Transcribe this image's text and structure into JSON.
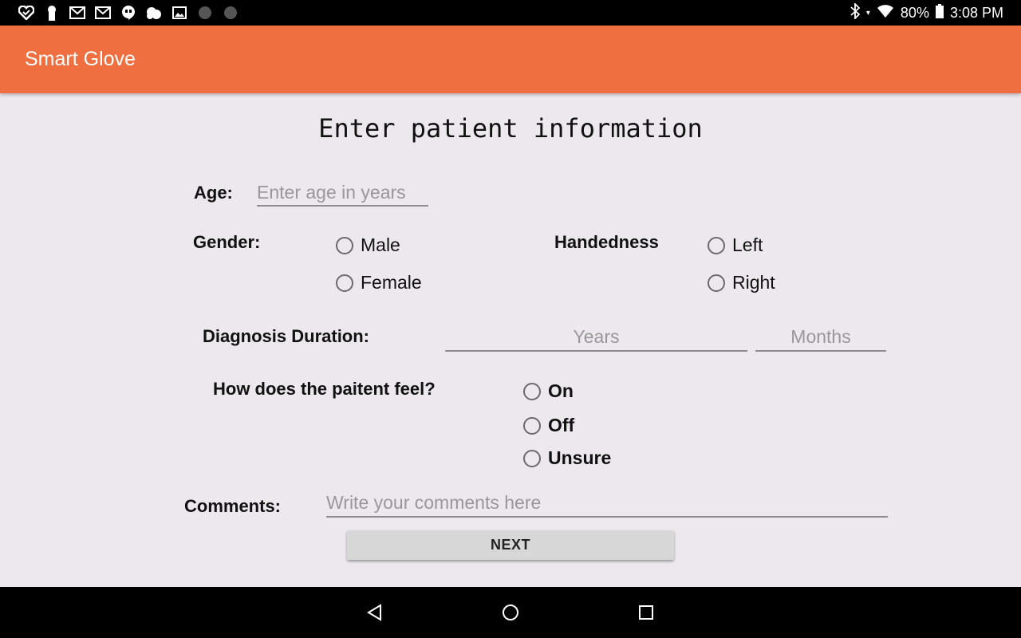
{
  "status_bar": {
    "notification_icons": [
      "heart-icon",
      "keyhole-icon",
      "mail-icon",
      "mail-icon",
      "hangouts-icon",
      "weather-icon",
      "image-icon",
      "circle-icon",
      "circle-icon"
    ],
    "battery": "80%",
    "time": "3:08 PM"
  },
  "app_bar": {
    "title": "Smart Glove",
    "color": "#ef6f40"
  },
  "form": {
    "title": "Enter patient information",
    "age": {
      "label": "Age:",
      "placeholder": "Enter age in years"
    },
    "gender": {
      "label": "Gender:",
      "options": [
        "Male",
        "Female"
      ]
    },
    "handedness": {
      "label": "Handedness",
      "options": [
        "Left",
        "Right"
      ]
    },
    "diagnosis": {
      "label": "Diagnosis Duration:",
      "years_placeholder": "Years",
      "months_placeholder": "Months"
    },
    "feel": {
      "label": "How does the paitent feel?",
      "options": [
        "On",
        "Off",
        "Unsure"
      ]
    },
    "comments": {
      "label": "Comments:",
      "placeholder": "Write your comments here"
    },
    "next_label": "NEXT"
  },
  "nav_bar": {
    "buttons": [
      "back-icon",
      "home-icon",
      "recents-icon"
    ]
  }
}
